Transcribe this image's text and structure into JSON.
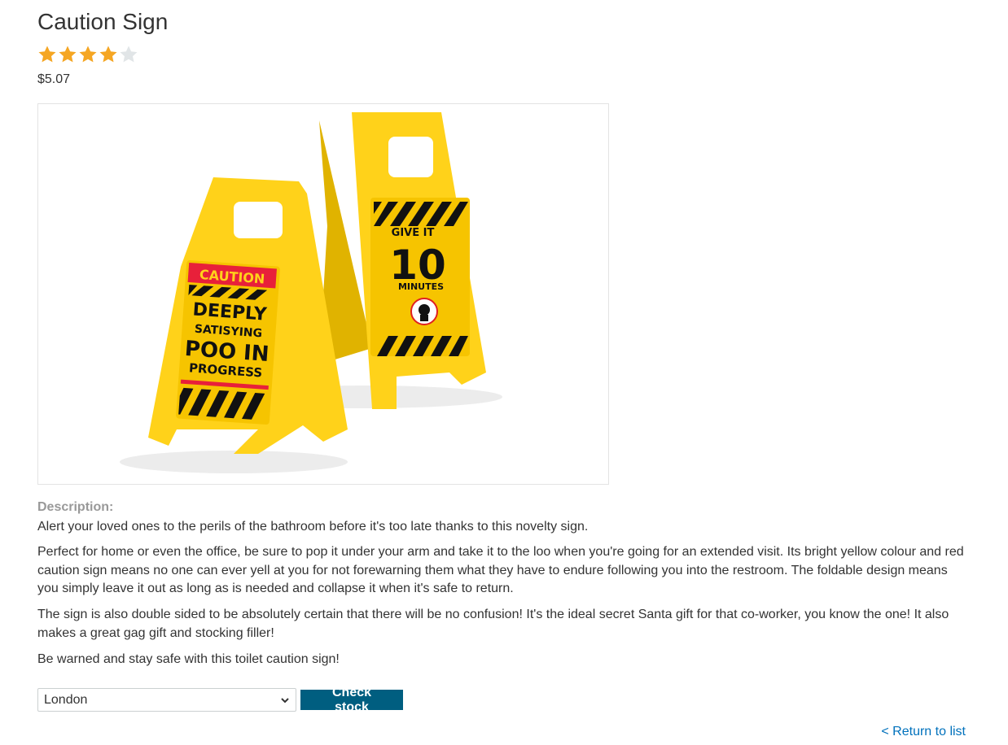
{
  "product": {
    "title": "Caution Sign",
    "rating": 4,
    "rating_max": 5,
    "price": "$5.07",
    "image_alt": "Caution Sign",
    "sign_front": {
      "banner": "CAUTION",
      "line1": "DEEPLY",
      "line2": "SATISYING",
      "line3": "POO IN",
      "line4": "PROGRESS"
    },
    "sign_back": {
      "line1": "GIVE IT",
      "line2": "10",
      "line3": "MINUTES"
    }
  },
  "description": {
    "label": "Description:",
    "paragraphs": [
      "Alert your loved ones to the perils of the bathroom before it's too late thanks to this novelty sign.",
      "Perfect for home or even the office, be sure to pop it under your arm and take it to the loo when you're going for an extended visit. Its bright yellow colour and red caution sign means no one can ever yell at you for not forewarning them what they have to endure following you into the restroom. The foldable design means you simply leave it out as long as is needed and collapse it when it's safe to return.",
      "The sign is also double sided to be absolutely certain that there will be no confusion! It's the ideal secret Santa gift for that co-worker, you know the one! It also makes a great gag gift and stocking filler!",
      "Be warned and stay safe with this toilet caution sign!"
    ]
  },
  "stock": {
    "selected_city": "London",
    "button_label": "Check stock"
  },
  "nav": {
    "return_label": "< Return to list"
  },
  "colors": {
    "star_filled": "#f5a623",
    "star_empty": "#e1e5e7",
    "button_bg": "#005e80",
    "link": "#0071bc",
    "sign_yellow": "#ffd21a"
  },
  "icons": {
    "star": "star-icon",
    "select_arrow": "chevron-down-icon"
  }
}
